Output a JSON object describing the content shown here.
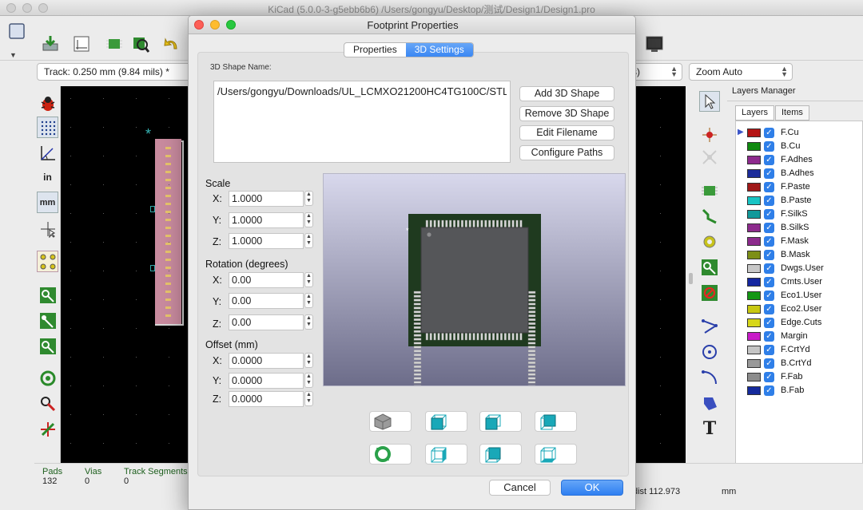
{
  "app": {
    "window_title": "KiCad (5.0.0-3-g5ebb6b6) /Users/gongyu/Desktop/测试/Design1/Design1.pro"
  },
  "toolbar": {
    "track_combo": "Track: 0.250 mm (9.84 mils) *",
    "via_combo_tail": "s)",
    "zoom_combo": "Zoom Auto"
  },
  "layers_manager": {
    "title": "Layers Manager",
    "tabs": [
      "Layers",
      "Items"
    ],
    "layers": [
      {
        "name": "F.Cu",
        "color": "#b51414",
        "active": true
      },
      {
        "name": "B.Cu",
        "color": "#0f8a0f"
      },
      {
        "name": "F.Adhes",
        "color": "#8e2a8e"
      },
      {
        "name": "B.Adhes",
        "color": "#1c2c9a"
      },
      {
        "name": "F.Paste",
        "color": "#a01818"
      },
      {
        "name": "B.Paste",
        "color": "#19c4c4"
      },
      {
        "name": "F.SilkS",
        "color": "#12999a"
      },
      {
        "name": "B.SilkS",
        "color": "#8d2b8d"
      },
      {
        "name": "F.Mask",
        "color": "#8c2a8c"
      },
      {
        "name": "B.Mask",
        "color": "#7d8f17"
      },
      {
        "name": "Dwgs.User",
        "color": "#c8c8c8"
      },
      {
        "name": "Cmts.User",
        "color": "#1426a0"
      },
      {
        "name": "Eco1.User",
        "color": "#139713"
      },
      {
        "name": "Eco2.User",
        "color": "#c8c812"
      },
      {
        "name": "Edge.Cuts",
        "color": "#d7d71a"
      },
      {
        "name": "Margin",
        "color": "#c81bc8"
      },
      {
        "name": "F.CrtYd",
        "color": "#c5c5c5"
      },
      {
        "name": "B.CrtYd",
        "color": "#999999"
      },
      {
        "name": "F.Fab",
        "color": "#8c8c8c"
      },
      {
        "name": "B.Fab",
        "color": "#152a9c"
      }
    ]
  },
  "status": {
    "pads_label": "Pads",
    "pads_value": "132",
    "vias_label": "Vias",
    "vias_value": "0",
    "segments_label": "Track Segments",
    "segments_value": "0",
    "dist": "dist 112.973",
    "units": "mm"
  },
  "dialog": {
    "title": "Footprint Properties",
    "tabs": [
      "Properties",
      "3D Settings"
    ],
    "shape_name_label": "3D Shape Name:",
    "shape_path": "/Users/gongyu/Downloads/UL_LCMXO21200HC4TG100C/STL...",
    "buttons": {
      "add": "Add 3D Shape",
      "remove": "Remove 3D Shape",
      "edit": "Edit Filename",
      "configure": "Configure Paths",
      "cancel": "Cancel",
      "ok": "OK"
    },
    "scale": {
      "label": "Scale",
      "x": "1.0000",
      "y": "1.0000",
      "z": "1.0000"
    },
    "rotation": {
      "label": "Rotation (degrees)",
      "x": "0.00",
      "y": "0.00",
      "z": "0.00"
    },
    "offset": {
      "label": "Offset (mm)",
      "x": "0.0000",
      "y": "0.0000",
      "z": "0.0000"
    },
    "axis": {
      "x": "X:",
      "y": "Y:",
      "z": "Z:"
    }
  }
}
